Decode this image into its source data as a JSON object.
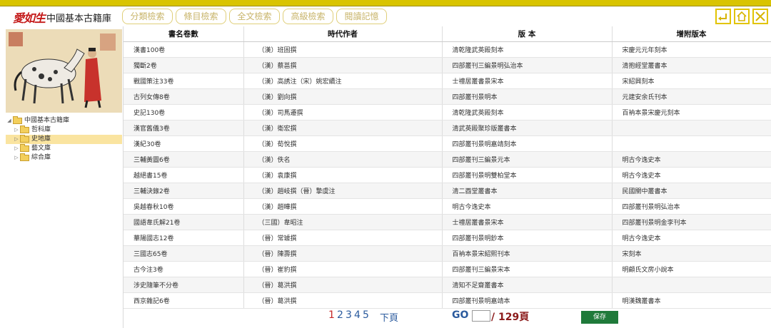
{
  "header": {
    "logo_mark": "愛如生",
    "app_title": "中國基本古籍庫",
    "nav": [
      "分類檢索",
      "條目檢索",
      "全文檢索",
      "高級檢索",
      "閱讀記憶"
    ],
    "window_icons": [
      "back-icon",
      "home-icon",
      "close-icon"
    ]
  },
  "sidebar": {
    "tree": [
      {
        "label": "中國基本古籍庫",
        "level": 0,
        "expanded": true
      },
      {
        "label": "哲科庫",
        "level": 1
      },
      {
        "label": "史地庫",
        "level": 1,
        "selected": true
      },
      {
        "label": "藝文庫",
        "level": 1
      },
      {
        "label": "綜合庫",
        "level": 1
      }
    ]
  },
  "table": {
    "headers": [
      "書名卷數",
      "時代作者",
      "版 本",
      "增附版本"
    ],
    "rows": [
      [
        "漢書100卷",
        "（漢）班固撰",
        "清乾隆武英殿刻本",
        "宋慶元元年刻本"
      ],
      [
        "獨斷2卷",
        "（漢）蔡邕撰",
        "四部叢刊三編景明弘治本",
        "清抱經堂叢書本"
      ],
      [
        "戰國策注33卷",
        "（漢）高誘注（宋）姚宏續注",
        "士禮居叢書景宋本",
        "宋紹興刻本"
      ],
      [
        "古列女傳8卷",
        "（漢）劉向撰",
        "四部叢刊景明本",
        "元建安余氏刊本"
      ],
      [
        "史記130卷",
        "（漢）司馬遷撰",
        "清乾隆武英殿刻本",
        "百衲本景宋慶元刻本"
      ],
      [
        "漢官舊儀3卷",
        "（漢）衛宏撰",
        "清武英殿聚珍版叢書本",
        ""
      ],
      [
        "漢紀30卷",
        "（漢）荀悅撰",
        "四部叢刊景明嘉靖刻本",
        ""
      ],
      [
        "三輔黃圖6卷",
        "（漢）佚名",
        "四部叢刊三編景元本",
        "明古今逸史本"
      ],
      [
        "越絕書15卷",
        "（漢）袁康撰",
        "四部叢刊景明雙柏堂本",
        "明古今逸史本"
      ],
      [
        "三輔決錄2卷",
        "（漢）趙岐撰（晉）摯虞注",
        "清二酉堂叢書本",
        "民國關中叢書本"
      ],
      [
        "吳越春秋10卷",
        "（漢）趙曄撰",
        "明古今逸史本",
        "四部叢刊景明弘治本"
      ],
      [
        "國語韋氏解21卷",
        "（三國）韋昭注",
        "士禮居叢書景宋本",
        "四部叢刊景明金李刊本"
      ],
      [
        "華陽國志12卷",
        "（晉）常璩撰",
        "四部叢刊景明鈔本",
        "明古今逸史本"
      ],
      [
        "三國志65卷",
        "（晉）陳壽撰",
        "百衲本景宋紹熙刊本",
        "宋刻本"
      ],
      [
        "古今注3卷",
        "（晉）崔豹撰",
        "四部叢刊三編景宋本",
        "明顧氏文房小說本"
      ],
      [
        "涉史隨筆不分卷",
        "（晉）葛洪撰",
        "清知不足齋叢書本",
        ""
      ],
      [
        "西京雜記6卷",
        "（晉）葛洪撰",
        "四部叢刊景明嘉靖本",
        "明漢魏叢書本"
      ]
    ]
  },
  "pager": {
    "pages": [
      "1",
      "2",
      "3",
      "4",
      "5"
    ],
    "current": "1",
    "next_label": "下頁",
    "go_label": "GO",
    "go_value": "",
    "total_label": "/ 129頁",
    "save_label": "保存"
  }
}
